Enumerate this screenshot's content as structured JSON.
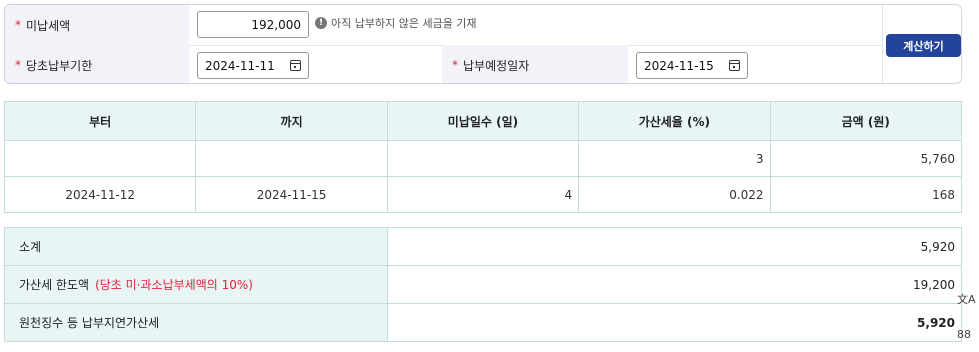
{
  "form": {
    "unpaid_label": "미납세액",
    "unpaid_value": "192,000",
    "hint": "아직 납부하지 않은 세금을 기재",
    "hint_icon": "!",
    "due_label": "당초납부기한",
    "due_value": "2024-11-11",
    "planned_label": "납부예정일자",
    "planned_value": "2024-11-15",
    "required_mark": "*",
    "calc_button": "계산하기"
  },
  "rate_table": {
    "headers": [
      "부터",
      "까지",
      "미납일수 (일)",
      "가산세율 (%)",
      "금액 (원)"
    ],
    "rows": [
      [
        "",
        "",
        "",
        "3",
        "5,760"
      ],
      [
        "2024-11-12",
        "2024-11-15",
        "4",
        "0.022",
        "168"
      ]
    ]
  },
  "summary": {
    "subtotal_label": "소계",
    "subtotal_value": "5,920",
    "limit_label": "가산세 한도액",
    "limit_note": "(당초 미·과소납부세액의 10%)",
    "limit_value": "19,200",
    "withholding_label": "원천징수 등 납부지연가산세",
    "withholding_value": "5,920"
  },
  "side": {
    "translate_icon": "文A",
    "apps_icon": "88"
  }
}
